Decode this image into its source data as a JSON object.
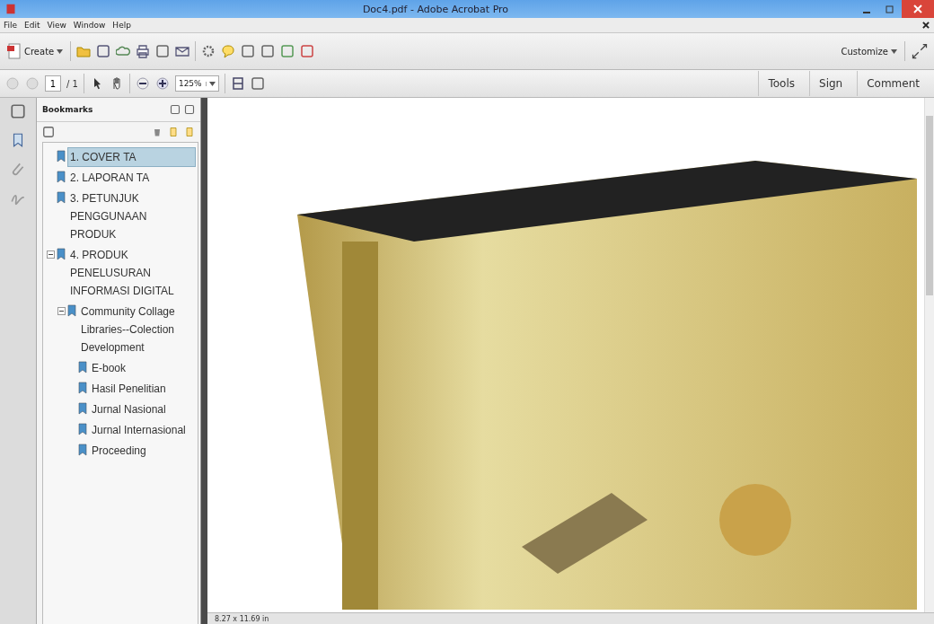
{
  "window": {
    "title": "Doc4.pdf - Adobe Acrobat Pro"
  },
  "menu": [
    "File",
    "Edit",
    "View",
    "Window",
    "Help"
  ],
  "toolbar": {
    "create": "Create",
    "customize": "Customize"
  },
  "nav": {
    "page": "1",
    "of": "/ 1",
    "zoom": "125%"
  },
  "panes": [
    "Tools",
    "Sign",
    "Comment"
  ],
  "bookmarks": {
    "title": "Bookmarks",
    "items": [
      {
        "label": "1. COVER TA",
        "selected": true
      },
      {
        "label": "2. LAPORAN TA",
        "selected": false
      },
      {
        "label": "3. PETUNJUK PENGGUNAAN PRODUK",
        "selected": false
      },
      {
        "label": "4. PRODUK PENELUSURAN INFORMASI DIGITAL",
        "selected": false,
        "expanded": true,
        "children": [
          {
            "label": "Community Collage Libraries--Colection Development",
            "selected": false,
            "expanded": true,
            "children": [
              {
                "label": "E-book",
                "selected": false
              },
              {
                "label": "Hasil Penelitian",
                "selected": false
              },
              {
                "label": "Jurnal Nasional",
                "selected": false
              },
              {
                "label": "Jurnal Internasional",
                "selected": false
              },
              {
                "label": "Proceeding",
                "selected": false
              }
            ]
          }
        ]
      }
    ]
  },
  "status": {
    "page_size": "8.27 x 11.69 in"
  }
}
